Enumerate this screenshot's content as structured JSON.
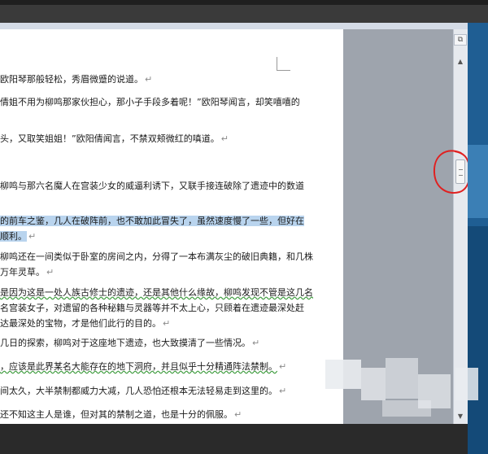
{
  "document": {
    "paragraphs": [
      {
        "lines": [
          "欧阳琴那般轻松，秀眉微蹙的说道。"
        ]
      },
      {
        "lines": [
          "倩姐不用为柳鸣那家伙担心，那小子手段多着呢！”欧阳琴闻言，却笑嘻嘻的"
        ]
      },
      {
        "lines": [
          "头，又取笑姐姐！”欧阳倩闻言，不禁双颊微红的嗔道。"
        ]
      },
      {
        "lines": [
          "柳鸣与那六名魔人在宫装少女的威逼利诱下，又联手接连破除了遗迹中的数道"
        ]
      },
      {
        "lines": [
          "的前车之鉴，几人在破阵前，也不敢加此冒失了，虽然速度慢了一些，但好在",
          "顺利。"
        ],
        "highlighted": true
      },
      {
        "lines": [
          "柳鸣还在一间类似于卧室的房间之内，分得了一本布满灰尘的破旧典籍，和几株",
          "万年灵草。"
        ]
      },
      {
        "lines": [
          "是因为这是一处人族古修士的遗迹，还是其他什么缘故，柳鸣发现不管是这几名",
          "名宫装女子，对遗留的各种秘籍与灵器等并不太上心，只顾着在遗迹最深处赶",
          "达最深处的宝物，才是他们此行的目的。"
        ]
      },
      {
        "lines": [
          "几日的探索，柳鸣对于这座地下遗迹，也大致摸清了一些情况。"
        ]
      },
      {
        "lines": [
          "，应该是此界某名大能存在的地下洞府，并且似乎十分精通阵法禁制。"
        ]
      },
      {
        "lines": [
          "间太久，大半禁制都威力大减，几人恐怕还根本无法轻易走到这里的。"
        ]
      },
      {
        "lines": [
          "还不知这主人是谁，但对其的禁制之道，也是十分的佩服。"
        ]
      }
    ]
  },
  "scrollbar": {
    "top_button_icon": "split-view-icon",
    "up_arrow": "▲",
    "down_arrow": "▼"
  },
  "colors": {
    "selection_highlight": "#b9d4ee",
    "grammar_underline": "#3a9a3a"
  }
}
